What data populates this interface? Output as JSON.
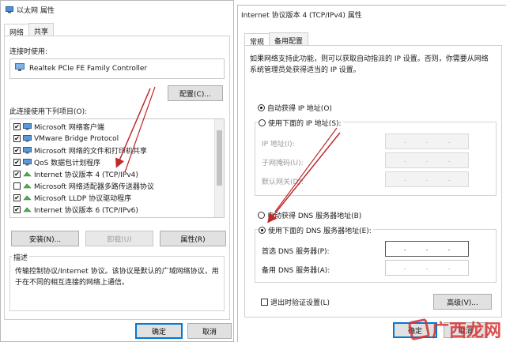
{
  "left_window": {
    "title": "以太网 属性",
    "tabs": [
      "网络",
      "共享"
    ],
    "connect_using_label": "连接时使用:",
    "adapter_name": "Realtek PCIe FE Family Controller",
    "configure_button": "配置(C)...",
    "items_label": "此连接使用下列项目(O):",
    "items": [
      {
        "label": "Microsoft 网络客户端",
        "checked": true,
        "icon": "network-client-icon"
      },
      {
        "label": "VMware Bridge Protocol",
        "checked": true,
        "icon": "network-client-icon"
      },
      {
        "label": "Microsoft 网络的文件和打印机共享",
        "checked": true,
        "icon": "network-client-icon"
      },
      {
        "label": "QoS 数据包计划程序",
        "checked": true,
        "icon": "network-client-icon"
      },
      {
        "label": "Internet 协议版本 4 (TCP/IPv4)",
        "checked": true,
        "icon": "protocol-icon"
      },
      {
        "label": "Microsoft 网络适配器多路传送器协议",
        "checked": false,
        "icon": "protocol-icon"
      },
      {
        "label": "Microsoft LLDP 协议驱动程序",
        "checked": true,
        "icon": "protocol-icon"
      },
      {
        "label": "Internet 协议版本 6 (TCP/IPv6)",
        "checked": true,
        "icon": "protocol-icon"
      }
    ],
    "install_button": "安装(N)...",
    "uninstall_button": "卸载(U)",
    "properties_button": "属性(R)",
    "description_title": "描述",
    "description_text": "传输控制协议/Internet 协议。该协议是默认的广域网络协议，用于在不同的相互连接的网络上通信。",
    "ok_button": "确定",
    "cancel_button": "取消"
  },
  "right_window": {
    "title": "Internet 协议版本 4 (TCP/IPv4) 属性",
    "tabs": [
      "常规",
      "备用配置"
    ],
    "intro": "如果网络支持此功能，则可以获取自动指派的 IP 设置。否则，你需要从网络系统管理员处获得适当的 IP 设置。",
    "auto_ip": "自动获得 IP 地址(O)",
    "manual_ip": "使用下面的 IP 地址(S):",
    "ip_address_label": "IP 地址(I):",
    "subnet_label": "子网掩码(U):",
    "gateway_label": "默认网关(D):",
    "auto_dns": "自动获得 DNS 服务器地址(B)",
    "manual_dns": "使用下面的 DNS 服务器地址(E):",
    "preferred_dns_label": "首选 DNS 服务器(P):",
    "alternate_dns_label": "备用 DNS 服务器(A):",
    "validate_on_exit": "退出时验证设置(L)",
    "advanced_button": "高级(V)...",
    "ok_button": "确定",
    "cancel_button": "取消",
    "ip_dot": ".",
    "selected_ip_option": "auto",
    "selected_dns_option": "manual"
  },
  "watermark": {
    "text": "广西龙网",
    "color": "#d63030"
  },
  "colors": {
    "annotation_arrow": "#c0282a",
    "focus_border": "#0078d7"
  }
}
